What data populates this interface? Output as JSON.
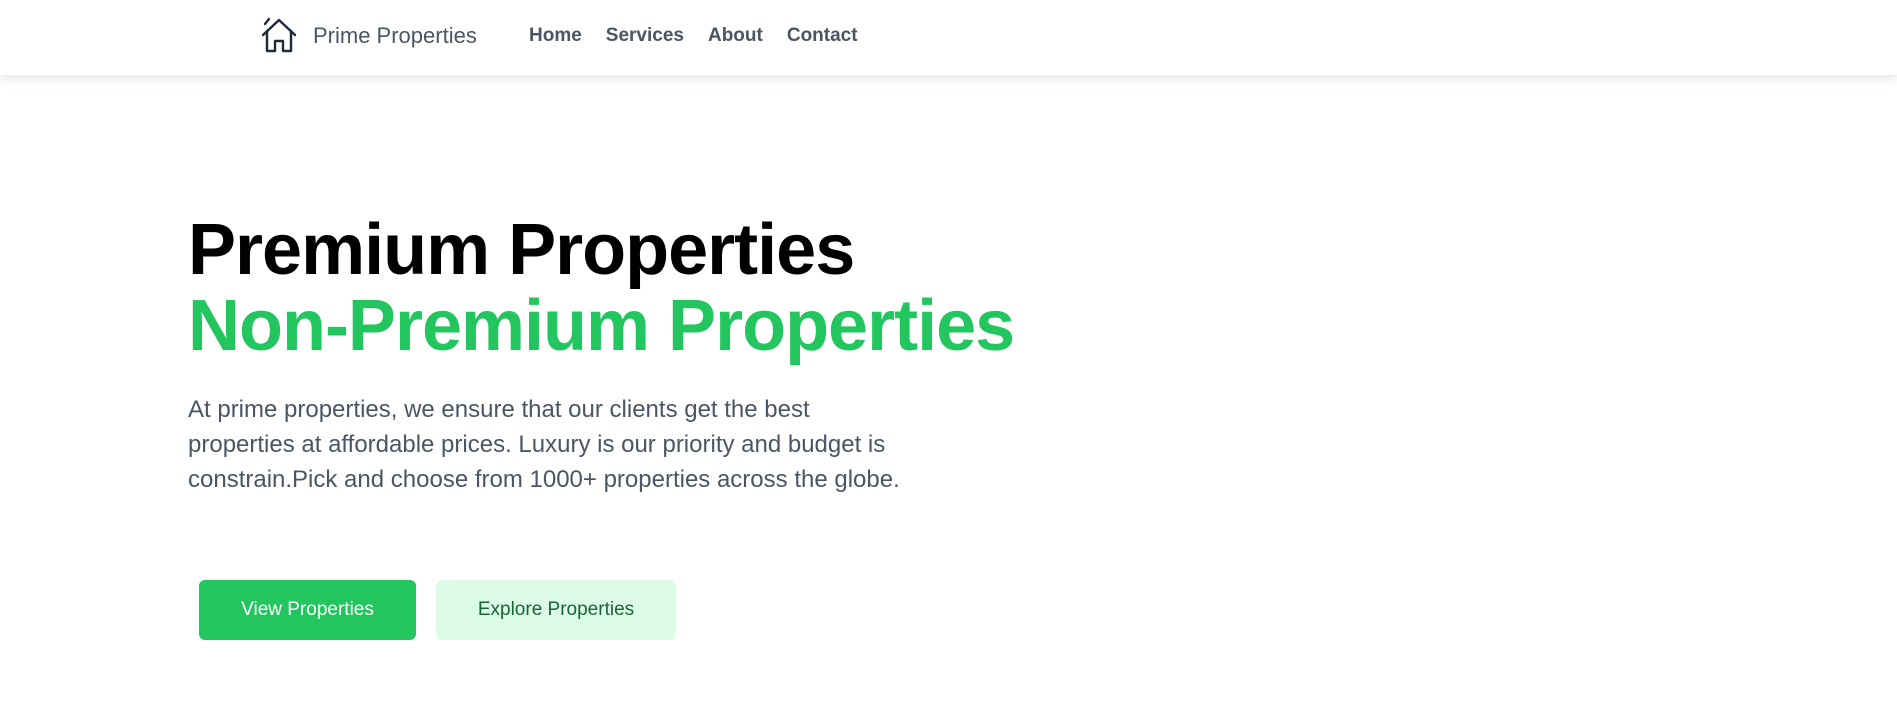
{
  "navbar": {
    "brand_icon": "house-icon",
    "brand_name": "Prime Properties",
    "links": [
      "Home",
      "Services",
      "About",
      "Contact"
    ]
  },
  "hero": {
    "title_line1": "Premium Properties",
    "title_line2": "Non-Premium Properties",
    "description": "At prime properties, we ensure that our clients get the best properties at affordable prices. Luxury is our priority and budget is constrain.Pick and choose from 1000+ properties across the globe.",
    "primary_button": "View Properties",
    "secondary_button": "Explore Properties"
  },
  "colors": {
    "accent": "#22c55e",
    "accent_light": "#dcfce7",
    "text_muted": "#4b5563",
    "heading": "#000000"
  }
}
